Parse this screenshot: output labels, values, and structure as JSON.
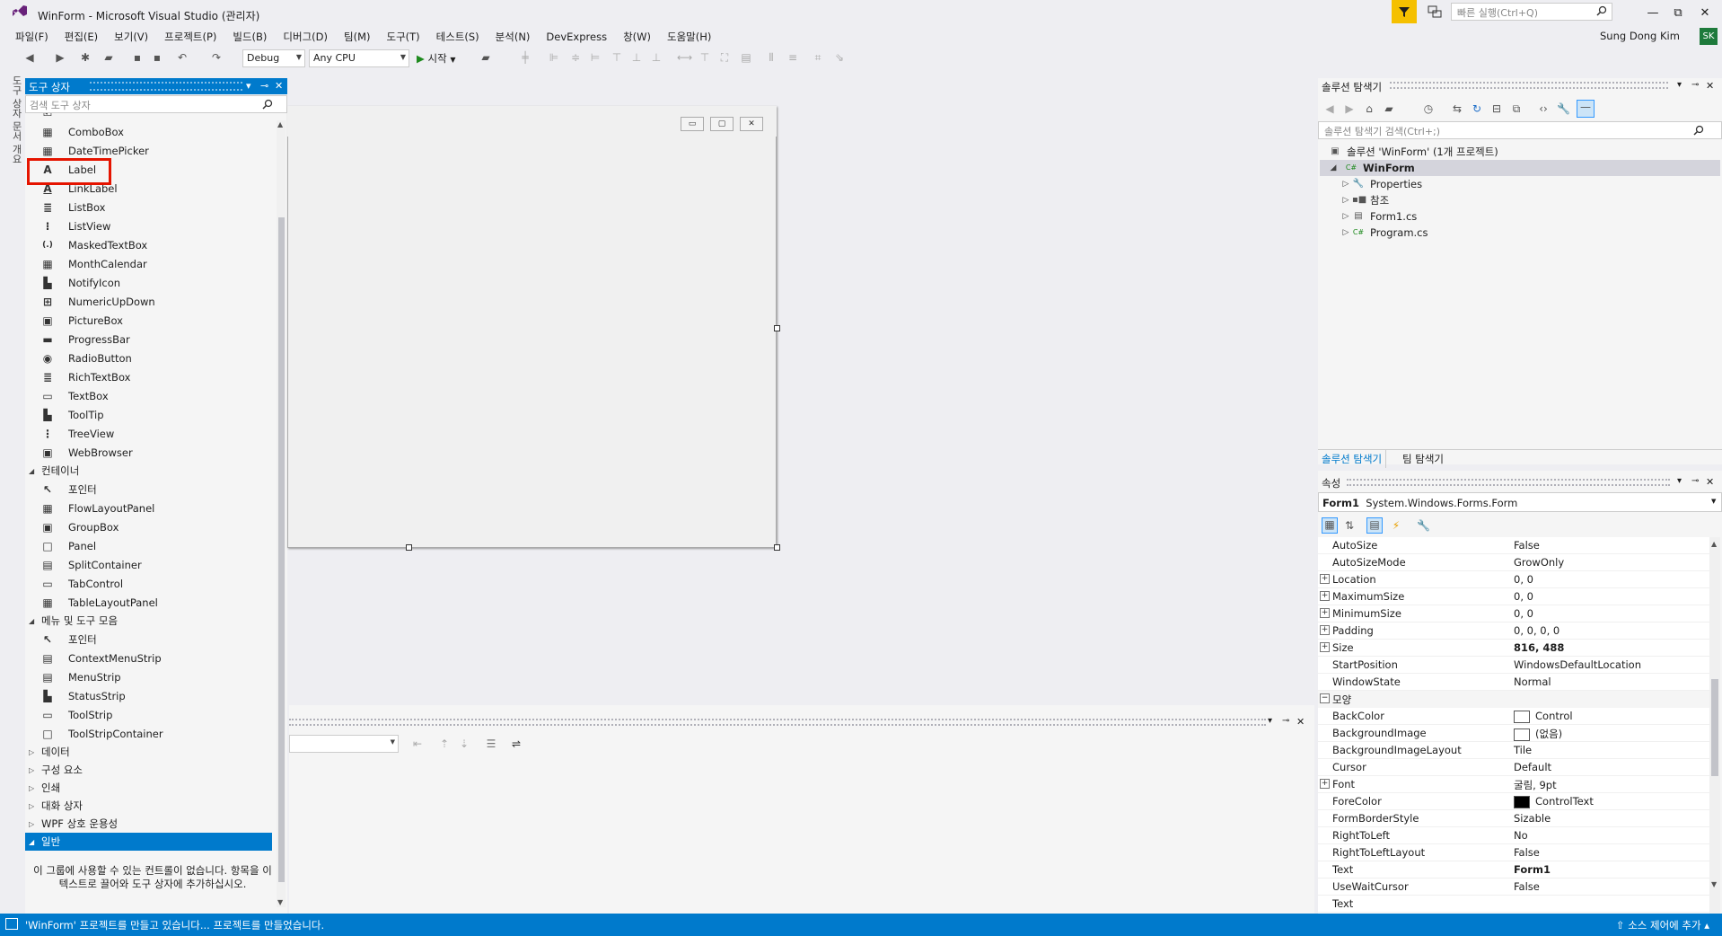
{
  "window": {
    "title": "WinForm - Microsoft Visual Studio  (관리자)",
    "quick_launch_placeholder": "빠른 실행(Ctrl+Q)",
    "user": "Sung Dong Kim",
    "avatar_initials": "SK"
  },
  "menu": [
    "파일(F)",
    "편집(E)",
    "보기(V)",
    "프로젝트(P)",
    "빌드(B)",
    "디버그(D)",
    "팀(M)",
    "도구(T)",
    "테스트(S)",
    "분석(N)",
    "DevExpress",
    "창(W)",
    "도움말(H)"
  ],
  "toolbar": {
    "config": "Debug",
    "platform": "Any CPU",
    "start_label": "시작"
  },
  "vertical_tabs": "도구 상자  문서 개요",
  "toolbox": {
    "title": "도구 상자",
    "search_placeholder": "검색 도구 상자",
    "items_top": [
      {
        "label": "ComboBox",
        "icon": "▦"
      },
      {
        "label": "DateTimePicker",
        "icon": "▦"
      },
      {
        "label": "Label",
        "icon": "A"
      },
      {
        "label": "LinkLabel",
        "icon": "A"
      },
      {
        "label": "ListBox",
        "icon": "≣"
      },
      {
        "label": "ListView",
        "icon": "⁝"
      },
      {
        "label": "MaskedTextBox",
        "icon": "(.)"
      },
      {
        "label": "MonthCalendar",
        "icon": "▦"
      },
      {
        "label": "NotifyIcon",
        "icon": "▙"
      },
      {
        "label": "NumericUpDown",
        "icon": "⊞"
      },
      {
        "label": "PictureBox",
        "icon": "▣"
      },
      {
        "label": "ProgressBar",
        "icon": "▬"
      },
      {
        "label": "RadioButton",
        "icon": "◉"
      },
      {
        "label": "RichTextBox",
        "icon": "≣"
      },
      {
        "label": "TextBox",
        "icon": "▭"
      },
      {
        "label": "ToolTip",
        "icon": "▙"
      },
      {
        "label": "TreeView",
        "icon": "⋮"
      },
      {
        "label": "WebBrowser",
        "icon": "▣"
      }
    ],
    "group_container": "컨테이너",
    "items_container": [
      {
        "label": "포인터",
        "icon": "↖"
      },
      {
        "label": "FlowLayoutPanel",
        "icon": "▦"
      },
      {
        "label": "GroupBox",
        "icon": "▣"
      },
      {
        "label": "Panel",
        "icon": "□"
      },
      {
        "label": "SplitContainer",
        "icon": "▤"
      },
      {
        "label": "TabControl",
        "icon": "▭"
      },
      {
        "label": "TableLayoutPanel",
        "icon": "▦"
      }
    ],
    "group_menus": "메뉴 및 도구 모음",
    "items_menus": [
      {
        "label": "포인터",
        "icon": "↖"
      },
      {
        "label": "ContextMenuStrip",
        "icon": "▤"
      },
      {
        "label": "MenuStrip",
        "icon": "▤"
      },
      {
        "label": "StatusStrip",
        "icon": "▙"
      },
      {
        "label": "ToolStrip",
        "icon": "▭"
      },
      {
        "label": "ToolStripContainer",
        "icon": "□"
      }
    ],
    "groups_collapsed": [
      "데이터",
      "구성 요소",
      "인쇄",
      "대화 상자",
      "WPF 상호 운용성"
    ],
    "group_general": "일반",
    "empty_message": "이 그룹에 사용할 수 있는 컨트롤이 없습니다. 항목을 이 텍스트로 끌어와 도구 상자에 추가하십시오."
  },
  "solution_explorer": {
    "title": "솔루션 탐색기",
    "search_placeholder": "솔루션 탐색기 검색(Ctrl+;)",
    "solution_label": "솔루션 'WinForm' (1개 프로젝트)",
    "project": "WinForm",
    "children": [
      "Properties",
      "참조",
      "Form1.cs",
      "Program.cs"
    ],
    "tabs": [
      "솔루션 탐색기",
      "팀 탐색기"
    ]
  },
  "properties": {
    "title": "속성",
    "object_name": "Form1",
    "object_type": "System.Windows.Forms.Form",
    "rows_layout": [
      {
        "name": "AutoSize",
        "value": "False",
        "expand": false
      },
      {
        "name": "AutoSizeMode",
        "value": "GrowOnly",
        "expand": false
      },
      {
        "name": "Location",
        "value": "0, 0",
        "expand": true
      },
      {
        "name": "MaximumSize",
        "value": "0, 0",
        "expand": true
      },
      {
        "name": "MinimumSize",
        "value": "0, 0",
        "expand": true
      },
      {
        "name": "Padding",
        "value": "0, 0, 0, 0",
        "expand": true
      },
      {
        "name": "Size",
        "value": "816, 488",
        "expand": true,
        "bold": true
      },
      {
        "name": "StartPosition",
        "value": "WindowsDefaultLocation",
        "expand": false
      },
      {
        "name": "WindowState",
        "value": "Normal",
        "expand": false
      }
    ],
    "category_appearance": "모양",
    "rows_appearance": [
      {
        "name": "BackColor",
        "value": "Control",
        "expand": false,
        "swatch": "#ffffff"
      },
      {
        "name": "BackgroundImage",
        "value": "(없음)",
        "expand": false,
        "swatch": "#ffffff"
      },
      {
        "name": "BackgroundImageLayout",
        "value": "Tile",
        "expand": false
      },
      {
        "name": "Cursor",
        "value": "Default",
        "expand": false
      },
      {
        "name": "Font",
        "value": "굴림, 9pt",
        "expand": true
      },
      {
        "name": "ForeColor",
        "value": "ControlText",
        "expand": false,
        "swatch": "#000000"
      },
      {
        "name": "FormBorderStyle",
        "value": "Sizable",
        "expand": false
      },
      {
        "name": "RightToLeft",
        "value": "No",
        "expand": false
      },
      {
        "name": "RightToLeftLayout",
        "value": "False",
        "expand": false
      },
      {
        "name": "Text",
        "value": "Form1",
        "expand": false,
        "bold": true
      },
      {
        "name": "UseWaitCursor",
        "value": "False",
        "expand": false
      }
    ],
    "last_partial": "Text"
  },
  "status": {
    "message": "'WinForm' 프로젝트를 만들고 있습니다... 프로젝트를 만들었습니다.",
    "source_control": "소스 제어에 추가"
  },
  "colors": {
    "accent": "#007acc",
    "highlight_box": "#e51400",
    "filter_yellow": "#f5c000"
  }
}
